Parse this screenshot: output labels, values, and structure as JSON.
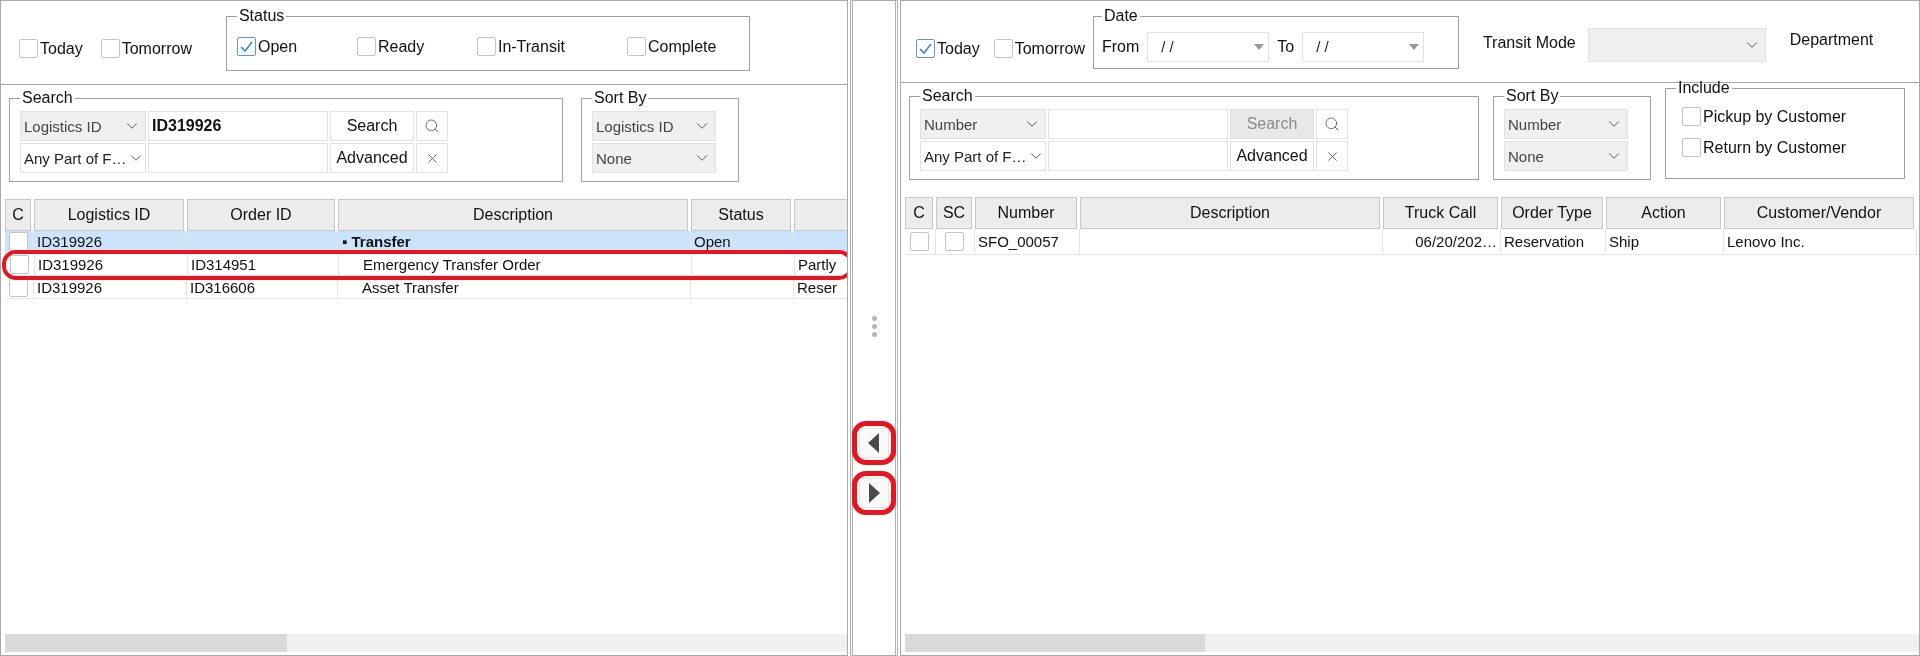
{
  "left": {
    "filters": {
      "days": [
        {
          "label": "Today",
          "checked": false
        },
        {
          "label": "Tomorrow",
          "checked": false
        }
      ],
      "status": {
        "title": "Status",
        "options": [
          {
            "label": "Open",
            "checked": true
          },
          {
            "label": "Ready",
            "checked": false
          },
          {
            "label": "In-Transit",
            "checked": false
          },
          {
            "label": "Complete",
            "checked": false
          }
        ]
      }
    },
    "search": {
      "title": "Search",
      "field": "Logistics ID",
      "query": "ID319926",
      "mode": "Any Part of F…",
      "search_button": {
        "label": "Search",
        "disabled": false
      },
      "advanced_button": "Advanced"
    },
    "sort": {
      "title": "Sort By",
      "primary": "Logistics ID",
      "secondary": "None"
    },
    "table": {
      "check_header": "C",
      "columns": [
        "Logistics ID",
        "Order ID",
        "Description",
        "Status"
      ],
      "rows": [
        {
          "checked": false,
          "selected": true,
          "highlighted": false,
          "group": true,
          "cells": [
            "ID319926",
            "",
            "▪ Transfer",
            "Open",
            ""
          ]
        },
        {
          "checked": false,
          "selected": false,
          "highlighted": true,
          "group": false,
          "cells": [
            "ID319926",
            "ID314951",
            "Emergency Transfer Order",
            "",
            "Partly"
          ]
        },
        {
          "checked": false,
          "selected": false,
          "highlighted": false,
          "group": false,
          "cells": [
            "ID319926",
            "ID316606",
            "Asset Transfer",
            "",
            "Reser"
          ]
        }
      ]
    }
  },
  "right": {
    "filters": {
      "days": [
        {
          "label": "Today",
          "checked": true
        },
        {
          "label": "Tomorrow",
          "checked": false
        }
      ],
      "date": {
        "title": "Date",
        "from_label": "From",
        "from_value": "/ /",
        "to_label": "To",
        "to_value": "/ /"
      },
      "transit_mode_label": "Transit Mode",
      "department_label": "Department"
    },
    "search": {
      "title": "Search",
      "field": "Number",
      "mode": "Any Part of F…",
      "search_button": {
        "label": "Search",
        "disabled": true
      },
      "advanced_button": "Advanced"
    },
    "sort": {
      "title": "Sort By",
      "primary": "Number",
      "secondary": "None"
    },
    "include": {
      "title": "Include",
      "options": [
        {
          "label": "Pickup by Customer",
          "checked": false
        },
        {
          "label": "Return by Customer",
          "checked": false
        }
      ]
    },
    "table": {
      "check_headers": [
        "C",
        "SC"
      ],
      "columns": [
        "Number",
        "Description",
        "Truck Call",
        "Order Type",
        "Action",
        "Customer/Vendor"
      ],
      "rows": [
        {
          "checked": false,
          "sc_checked": false,
          "cells": [
            "SFO_00057",
            "",
            "06/20/202…",
            "Reservation",
            "Ship",
            "Lenovo Inc."
          ]
        }
      ]
    }
  },
  "splitter": {
    "move_left_highlighted": true,
    "move_right_highlighted": true
  }
}
